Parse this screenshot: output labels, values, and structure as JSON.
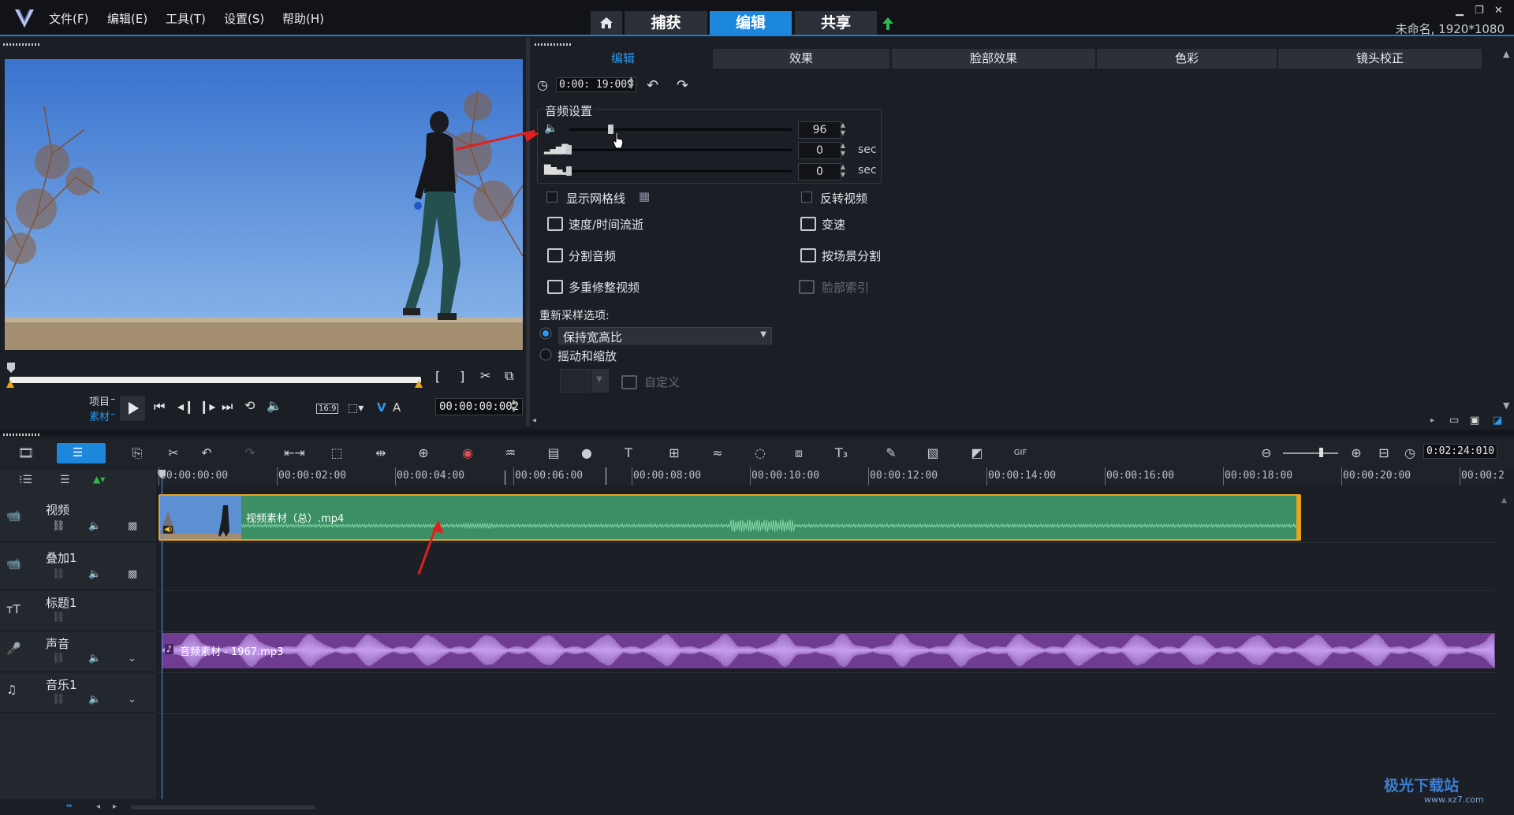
{
  "app": {
    "menu": [
      "文件(F)",
      "编辑(E)",
      "工具(T)",
      "设置(S)",
      "帮助(H)"
    ],
    "tabs": [
      "捕获",
      "编辑",
      "共享"
    ],
    "active_tab": "编辑",
    "project_info": "未命名, 1920*1080",
    "accent": "#1c87dd"
  },
  "player": {
    "mode_project": "项目",
    "mode_clip": "素材",
    "aspect": "16:9",
    "timecode": "00:00:00:002",
    "va_v": "V",
    "va_a": "A"
  },
  "options_panel": {
    "subtabs": [
      "编辑",
      "效果",
      "脸部效果",
      "色彩",
      "镜头校正"
    ],
    "active_subtab": "编辑",
    "duration": "0:00: 19:009",
    "audio_settings": {
      "title": "音频设置",
      "volume": "96",
      "fade_in": "0",
      "fade_out": "0",
      "unit": "sec"
    },
    "checkbox_grid": "显示网格线",
    "checkbox_reverse": "反转视频",
    "speed_time": "速度/时间流逝",
    "variable_speed": "变速",
    "split_audio": "分割音频",
    "split_by_scene": "按场景分割",
    "multi_trim": "多重修整视频",
    "face_index": "脸部索引",
    "resample_title": "重新采样选项:",
    "resample_keep": "保持宽高比",
    "resample_pan": "摇动和缩放",
    "custom": "自定义"
  },
  "timeline": {
    "timecode": "0:02:24:010",
    "ruler": [
      "00:00:00:00",
      "00:00:02:00",
      "00:00:04:00",
      "00:00:06:00",
      "00:00:08:00",
      "00:00:10:00",
      "00:00:12:00",
      "00:00:14:00",
      "00:00:16:00",
      "00:00:18:00",
      "00:00:20:00",
      "00:00:2"
    ],
    "tracks": [
      "视频",
      "叠加1",
      "标题1",
      "声音",
      "音乐1"
    ],
    "video_clip": "视频素材（总）.mp4",
    "audio_clip": "音频素材 - 1967.mp3",
    "video_clip_color": "#3c8e64",
    "audio_clip_color": "#6f3c91"
  },
  "watermark": {
    "name": "极光下载站",
    "url": "www.xz7.com"
  }
}
